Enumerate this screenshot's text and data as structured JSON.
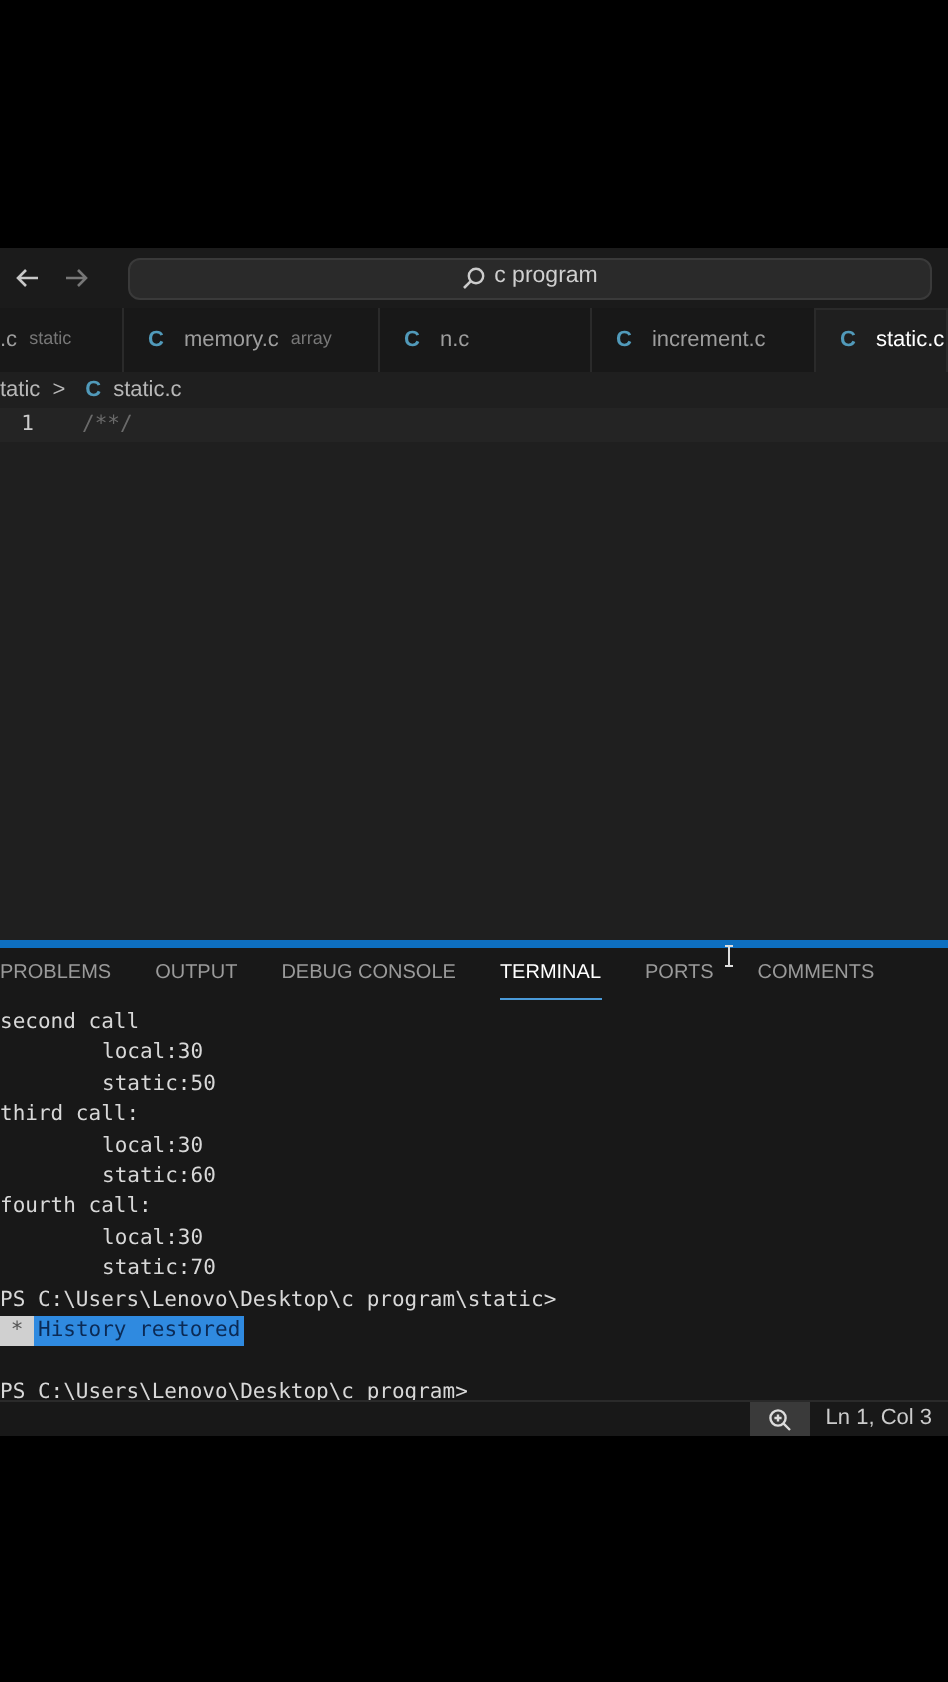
{
  "title_bar": {
    "search": "c program"
  },
  "tabs": [
    {
      "name": ".c",
      "description": "static",
      "selected": false
    },
    {
      "icon": "C",
      "name": "memory.c",
      "description": "array",
      "selected": false
    },
    {
      "icon": "C",
      "name": "n.c",
      "selected": false
    },
    {
      "icon": "C",
      "name": "increment.c",
      "selected": false
    },
    {
      "icon": "C",
      "name": "static.c",
      "selected": true
    }
  ],
  "breadcrumb": {
    "folder": "tatic",
    "separator": ">",
    "icon": "C",
    "file": "static.c"
  },
  "editor": {
    "lines": [
      {
        "number": "1",
        "code": "/**/"
      }
    ]
  },
  "panel_tabs": [
    {
      "label": "PROBLEMS",
      "selected": false
    },
    {
      "label": "OUTPUT",
      "selected": false
    },
    {
      "label": "DEBUG CONSOLE",
      "selected": false
    },
    {
      "label": "TERMINAL",
      "selected": true
    },
    {
      "label": "PORTS",
      "selected": false
    },
    {
      "label": "COMMENTS",
      "selected": false
    }
  ],
  "terminal": [
    {
      "kind": "heading",
      "text": "second call"
    },
    {
      "kind": "value",
      "text": "local:30"
    },
    {
      "kind": "value",
      "text": "static:50"
    },
    {
      "kind": "heading",
      "text": "third call:"
    },
    {
      "kind": "value",
      "text": "local:30"
    },
    {
      "kind": "value",
      "text": "static:60"
    },
    {
      "kind": "heading",
      "text": "fourth call:"
    },
    {
      "kind": "value",
      "text": "local:30"
    },
    {
      "kind": "value",
      "text": "static:70"
    },
    {
      "kind": "heading",
      "text": "PS C:\\Users\\Lenovo\\Desktop\\c program\\static>"
    },
    {
      "kind": "notice",
      "marker": "*",
      "text": "History restored"
    },
    {
      "kind": "blank"
    },
    {
      "kind": "heading",
      "text": "PS C:\\Users\\Lenovo\\Desktop\\c program>"
    }
  ],
  "status_bar": {
    "position": "Ln 1, Col 3"
  }
}
